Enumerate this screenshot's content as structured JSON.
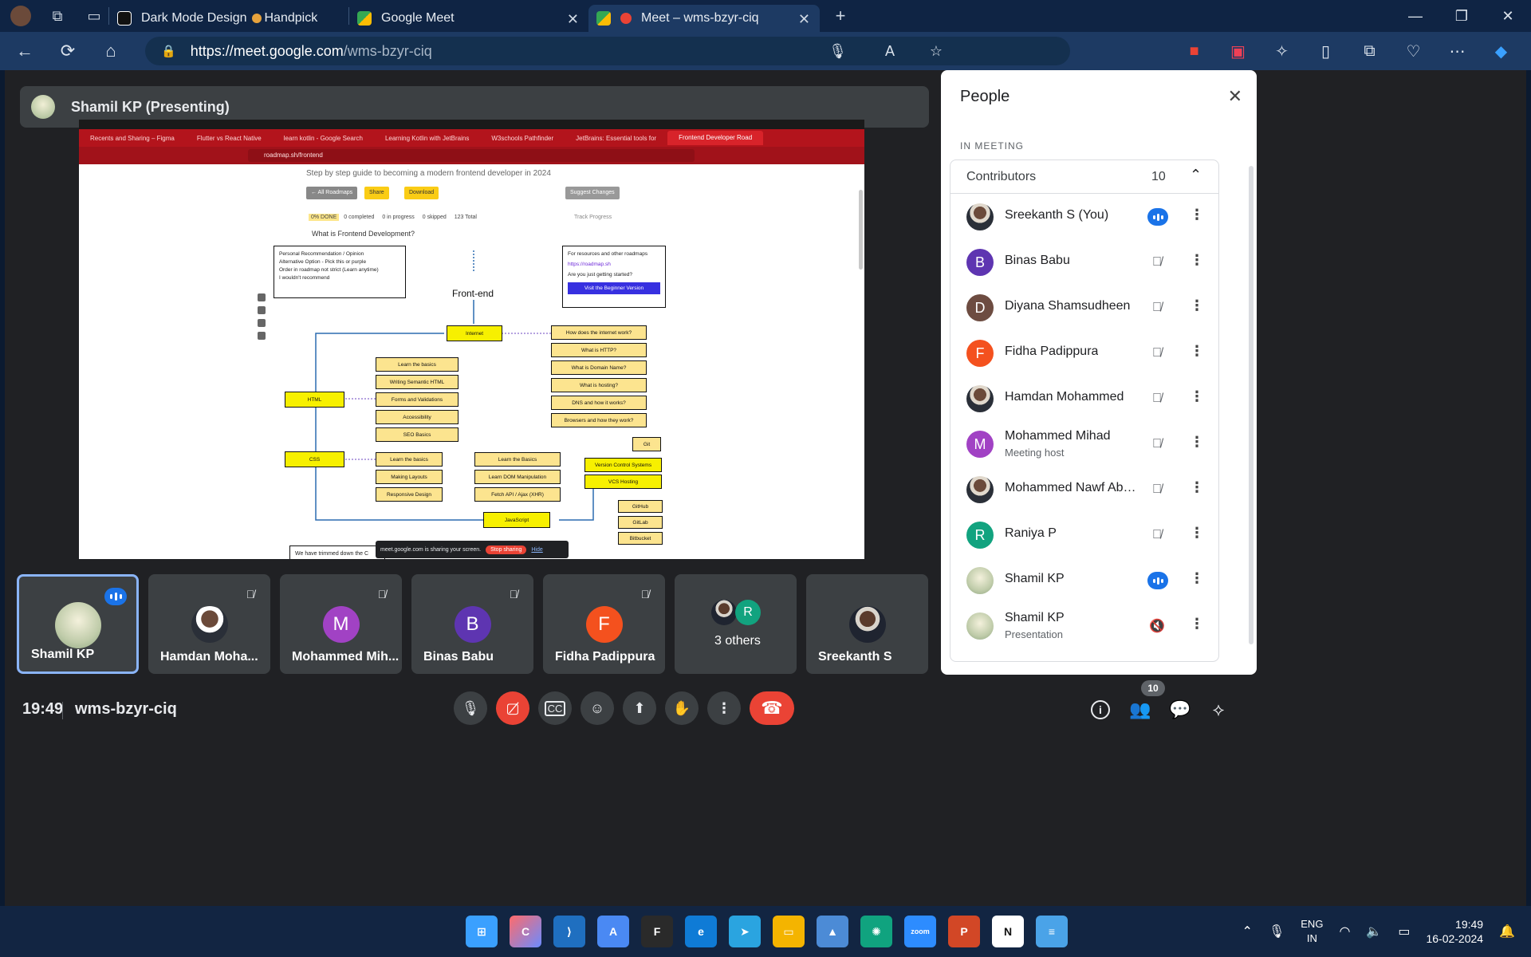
{
  "browser": {
    "tabs": [
      {
        "title": "Dark Mode Design",
        "extra": "Handpick",
        "active": false
      },
      {
        "title": "Google Meet",
        "active": false
      },
      {
        "title": "Meet – wms-bzyr-ciq",
        "active": true
      }
    ],
    "url_host": "https://meet.google.com",
    "url_path": "/wms-bzyr-ciq"
  },
  "meet": {
    "presenter_label": "Shamil KP (Presenting)",
    "time": "19:49",
    "meeting_code": "wms-bzyr-ciq",
    "participants_badge": "10"
  },
  "shared_screen": {
    "tabs": [
      "Recents and Sharing – Figma",
      "Flutter vs React Native",
      "learn kotlin - Google Search",
      "Learning Kotlin with JetBrains",
      "W3schools Pathfinder",
      "JetBrains: Essential tools for",
      "Frontend Developer Road"
    ],
    "url": "roadmap.sh/frontend",
    "subtitle": "Step by step guide to becoming a modern frontend developer in 2024",
    "buttons": {
      "all": "← All Roadmaps",
      "share": "Share",
      "download": "Download",
      "suggest": "Suggest Changes"
    },
    "progress": {
      "label": "0% DONE",
      "completed": "0 completed",
      "in_progress": "0 in progress",
      "skipped": "0 skipped",
      "total": "123 Total",
      "track": "Track Progress"
    },
    "faq": "What is Frontend Development?",
    "legend": [
      "Personal Recommendation / Opinion",
      "Alternative Option - Pick this or purple",
      "Order in roadmap not strict (Learn anytime)",
      "I wouldn't recommend"
    ],
    "resources": {
      "title": "For resources and other roadmaps",
      "link": "https://roadmap.sh",
      "q": "Are you just getting started?",
      "btn": "Visit the Beginner Version"
    },
    "roadmap_title": "Front-end",
    "nodes": {
      "internet": "Internet",
      "html": "HTML",
      "css": "CSS",
      "js": "JavaScript",
      "vcs": "Version Control Systems",
      "vcsh": "VCS Hosting",
      "git": "Git",
      "internet_q": [
        "How does the internet work?",
        "What is HTTP?",
        "What is Domain Name?",
        "What is hosting?",
        "DNS and how it works?",
        "Browsers and how they work?"
      ],
      "html_sub": [
        "Learn the basics",
        "Writing Semantic HTML",
        "Forms and Validations",
        "Accessibility",
        "SEO Basics"
      ],
      "css_sub": [
        "Learn the basics",
        "Making Layouts",
        "Responsive Design"
      ],
      "js_sub": [
        "Learn the Basics",
        "Learn DOM Manipulation",
        "Fetch API / Ajax (XHR)"
      ],
      "vcsh_sub": [
        "GitHub",
        "GitLab",
        "Bitbucket"
      ]
    },
    "toast": {
      "text": "meet.google.com is sharing your screen.",
      "stop": "Stop sharing",
      "hide": "Hide"
    },
    "trimmed": "We have trimmed down the C"
  },
  "tiles": [
    {
      "name": "Shamil KP",
      "initial": "",
      "color": "",
      "speaking": true,
      "muted": false
    },
    {
      "name": "Hamdan Moha...",
      "initial": "",
      "color": "",
      "speaking": false,
      "muted": true
    },
    {
      "name": "Mohammed Mih...",
      "initial": "M",
      "color": "#a142c4",
      "speaking": false,
      "muted": true
    },
    {
      "name": "Binas Babu",
      "initial": "B",
      "color": "#5e35b1",
      "speaking": false,
      "muted": true
    },
    {
      "name": "Fidha Padippura",
      "initial": "F",
      "color": "#f4511e",
      "speaking": false,
      "muted": true
    },
    {
      "name": "3 others",
      "initial": "R",
      "color": "#12a37f",
      "speaking": false,
      "muted": false
    },
    {
      "name": "Sreekanth S",
      "initial": "",
      "color": "",
      "speaking": false,
      "muted": false
    }
  ],
  "people": {
    "title": "People",
    "section": "IN MEETING",
    "group": "Contributors",
    "count": "10",
    "list": [
      {
        "name": "Sreekanth S (You)",
        "role": "",
        "initial": "",
        "color": "",
        "status": "speaking"
      },
      {
        "name": "Binas Babu",
        "role": "",
        "initial": "B",
        "color": "#5e35b1",
        "status": "muted"
      },
      {
        "name": "Diyana Shamsudheen",
        "role": "",
        "initial": "D",
        "color": "#6d4c41",
        "status": "muted"
      },
      {
        "name": "Fidha Padippura",
        "role": "",
        "initial": "F",
        "color": "#f4511e",
        "status": "muted"
      },
      {
        "name": "Hamdan Mohammed",
        "role": "",
        "initial": "",
        "color": "",
        "status": "muted"
      },
      {
        "name": "Mohammed Mihad",
        "role": "Meeting host",
        "initial": "M",
        "color": "#a142c4",
        "status": "muted"
      },
      {
        "name": "Mohammed Nawf Abdu...",
        "role": "",
        "initial": "",
        "color": "",
        "status": "muted"
      },
      {
        "name": "Raniya P",
        "role": "",
        "initial": "R",
        "color": "#12a37f",
        "status": "muted"
      },
      {
        "name": "Shamil KP",
        "role": "",
        "initial": "",
        "color": "",
        "status": "speaking"
      },
      {
        "name": "Shamil KP",
        "role": "Presentation",
        "initial": "",
        "color": "",
        "status": "audio-off"
      }
    ]
  },
  "taskbar": {
    "lang_top": "ENG",
    "lang_bottom": "IN",
    "time": "19:49",
    "date": "16-02-2024"
  }
}
